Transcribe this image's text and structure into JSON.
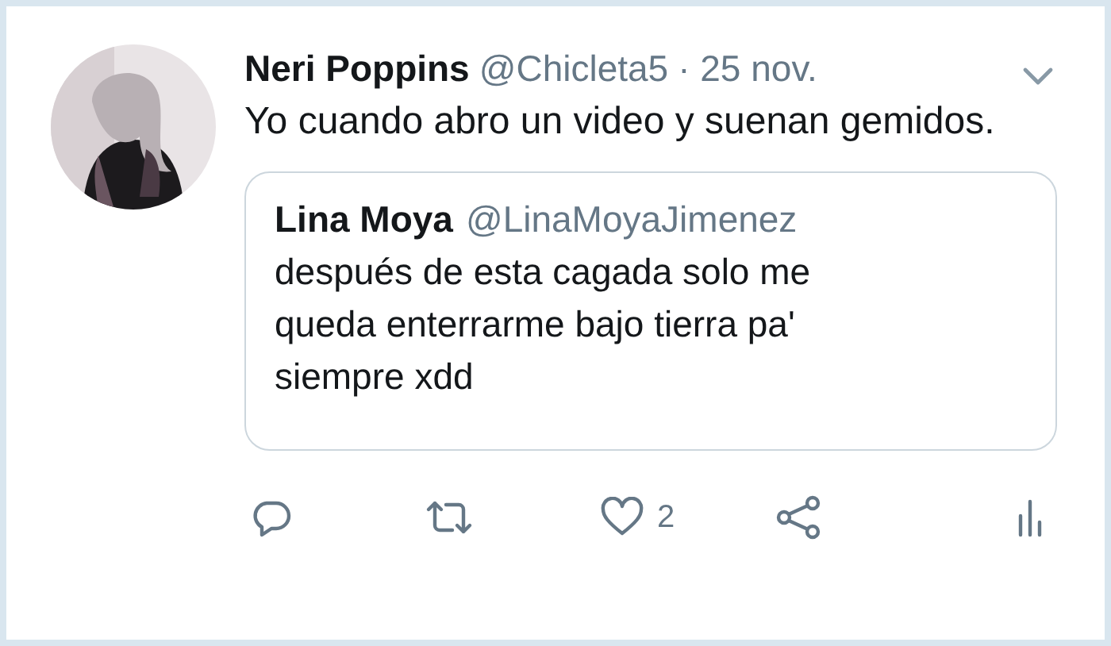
{
  "tweet": {
    "author": {
      "name": "Neri Poppins",
      "handle": "@Chicleta5",
      "date": "· 25 nov."
    },
    "text": "Yo cuando abro un video y suenan gemidos.",
    "quote": {
      "name": "Lina Moya",
      "handle": "@LinaMoyaJimenez",
      "text": "después de esta cagada solo me queda enterrarme bajo tierra pa' siempre xdd"
    },
    "actions": [
      {
        "kind": "reply"
      },
      {
        "kind": "retweet"
      },
      {
        "kind": "like",
        "count": "2"
      },
      {
        "kind": "share"
      },
      {
        "kind": "stats"
      }
    ]
  }
}
